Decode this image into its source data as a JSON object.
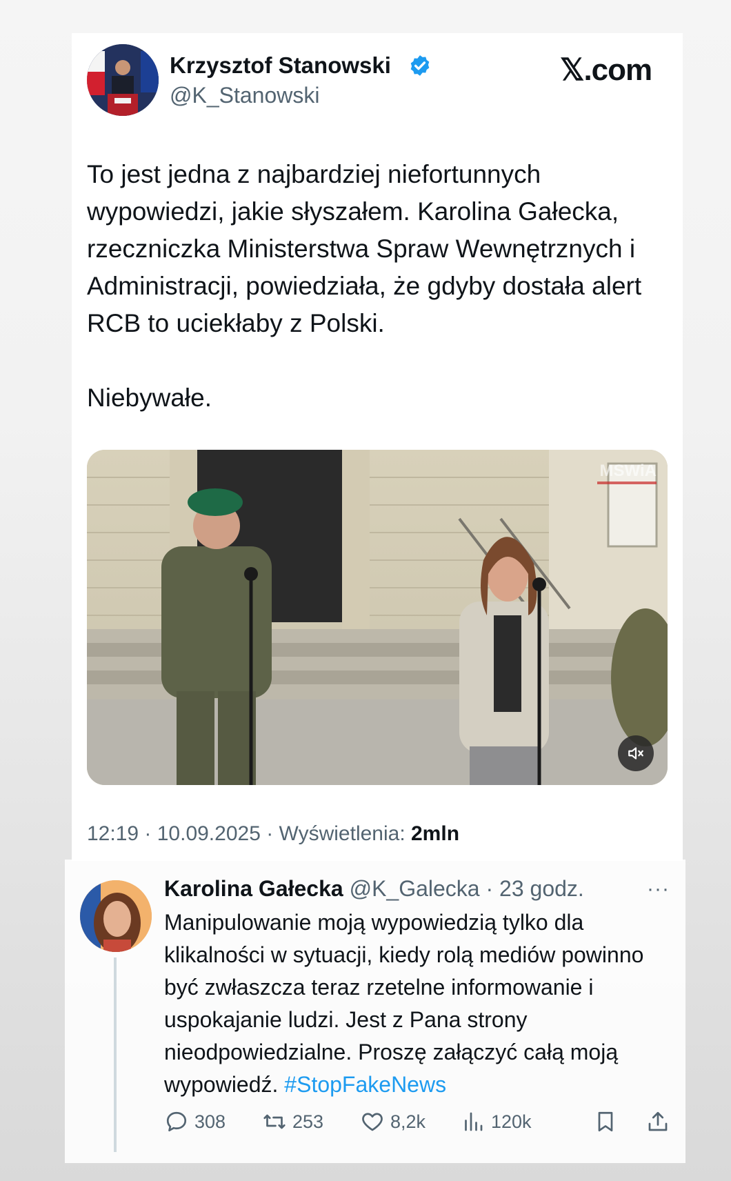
{
  "tweet": {
    "author_name": "Krzysztof Stanowski",
    "handle": "@K_Stanowski",
    "brand": "𝕏.com",
    "paragraphs": [
      "To jest jedna z najbardziej niefortunnych wypowiedzi, jakie słyszałem. Karolina Gałecka, rzeczniczka Ministerstwa Spraw Wewnętrznych i Administracji, powiedziała, że gdyby dostała alert RCB to uciekłaby z Polski.",
      "Niebywałe."
    ],
    "media_watermark": "MSWiA",
    "meta_time": "12:19 · 10.09.2025 · Wyświetlenia: ",
    "meta_views": "2mln"
  },
  "reply": {
    "author_name": "Karolina Gałecka",
    "handle": "@K_Galecka",
    "time": "· 23 godz.",
    "more": "···",
    "text": "Manipulowanie moją wypowiedzią tylko dla klikalności w sytuacji, kiedy rolą mediów powinno być zwłaszcza teraz rzetelne informowanie i uspokajanie ludzi. Jest z Pana strony nieodpowiedzialne. Proszę załączyć całą moją wypowiedź. ",
    "hashtag": "#StopFakeNews",
    "stats": {
      "replies": "308",
      "reposts": "253",
      "likes": "8,2k",
      "views": "120k"
    }
  },
  "colors": {
    "text": "#0f1419",
    "secondary": "#536471",
    "accent": "#1d9bf0"
  }
}
